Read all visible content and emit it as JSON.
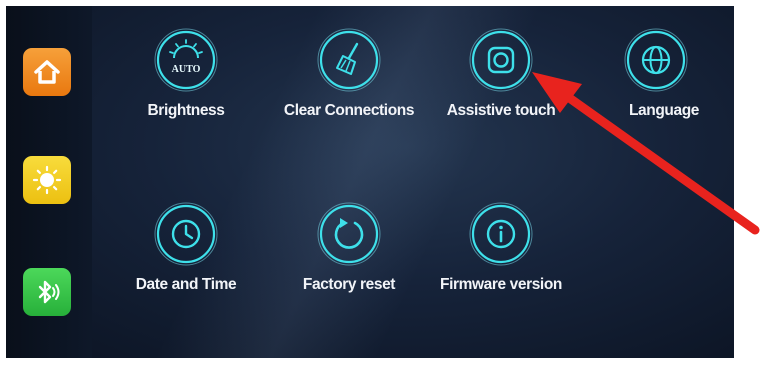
{
  "sidebar": {
    "items": [
      {
        "icon": "home-icon",
        "color": "#f28a1c"
      },
      {
        "icon": "sun-icon",
        "color": "#f2cf1f"
      },
      {
        "icon": "bluetooth-icon",
        "color": "#3cc84a"
      }
    ]
  },
  "settings": {
    "brightness": {
      "label": "Brightness",
      "icon": "brightness-auto-icon",
      "badge": "AUTO"
    },
    "clear_connections": {
      "label": "Clear Connections",
      "icon": "broom-icon"
    },
    "assistive_touch": {
      "label": "Assistive touch",
      "icon": "assistive-touch-icon"
    },
    "language": {
      "label": "Language",
      "icon": "globe-icon"
    },
    "date_time": {
      "label": "Date and Time",
      "icon": "clock-icon"
    },
    "factory_reset": {
      "label": "Factory reset",
      "icon": "reset-icon"
    },
    "firmware_version": {
      "label": "Firmware version",
      "icon": "info-icon"
    }
  },
  "annotation": {
    "color": "#e8231e",
    "target": "assistive-touch-icon"
  },
  "colors": {
    "accent": "#3ee0ea",
    "background": "#16233a"
  }
}
